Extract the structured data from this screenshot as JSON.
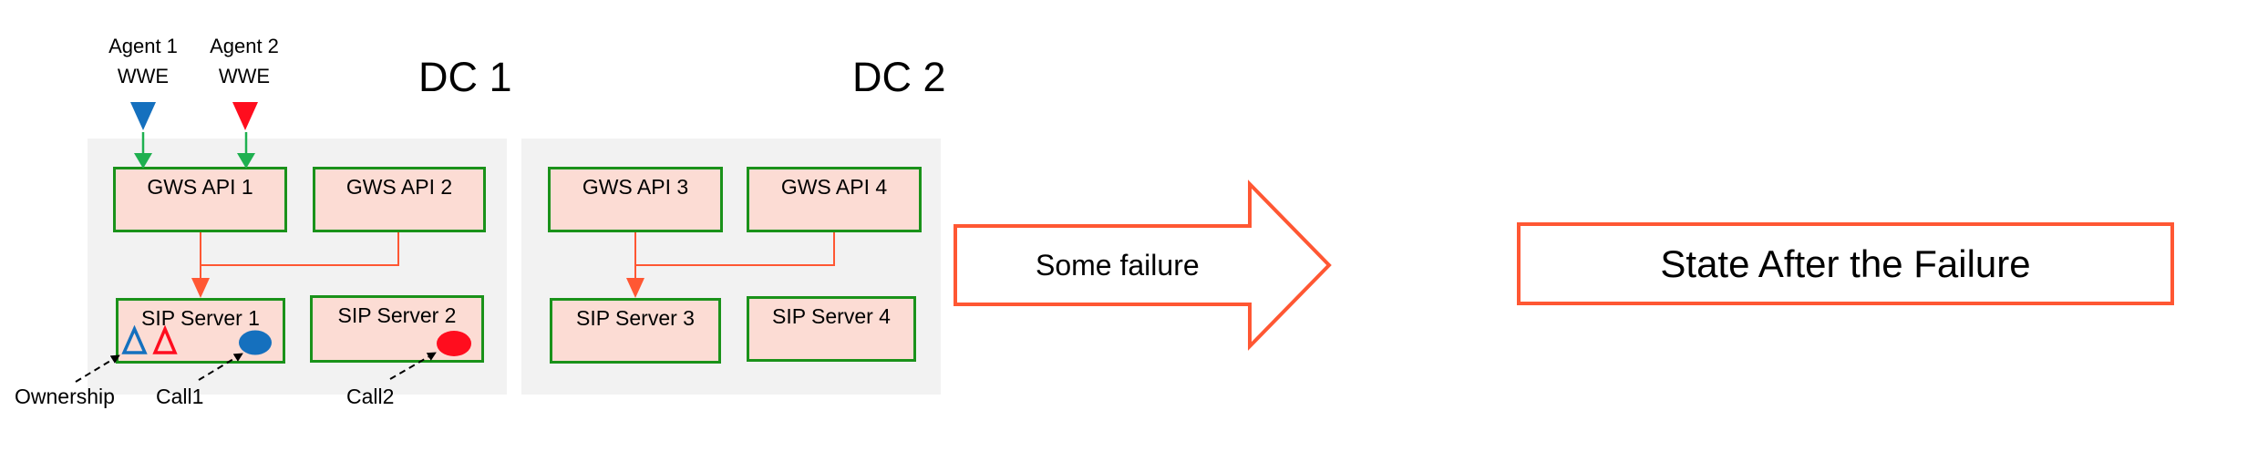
{
  "colors": {
    "panel_bg": "#f2f2f2",
    "component_fill": "#fcdcd4",
    "component_border": "#1a921a",
    "agent_link": "#1fb050",
    "internal_link": "#ff5733",
    "agent1": "#1570be",
    "agent2": "#ff0d1e",
    "transition_outline": "#ff5733"
  },
  "agents": [
    {
      "name": "Agent 1",
      "app": "WWE",
      "color_key": "agent1"
    },
    {
      "name": "Agent 2",
      "app": "WWE",
      "color_key": "agent2"
    }
  ],
  "datacenters": [
    {
      "label": "DC 1",
      "gws": [
        "GWS API 1",
        "GWS API 2"
      ],
      "sip": [
        "SIP Server 1",
        "SIP Server 2"
      ]
    },
    {
      "label": "DC 2",
      "gws": [
        "GWS API 3",
        "GWS API 4"
      ],
      "sip": [
        "SIP Server 3",
        "SIP Server 4"
      ]
    }
  ],
  "annotations": {
    "ownership": "Ownership",
    "call1": "Call1",
    "call2": "Call2"
  },
  "transition": {
    "label": "Some failure"
  },
  "result": {
    "label": "State After the Failure"
  }
}
